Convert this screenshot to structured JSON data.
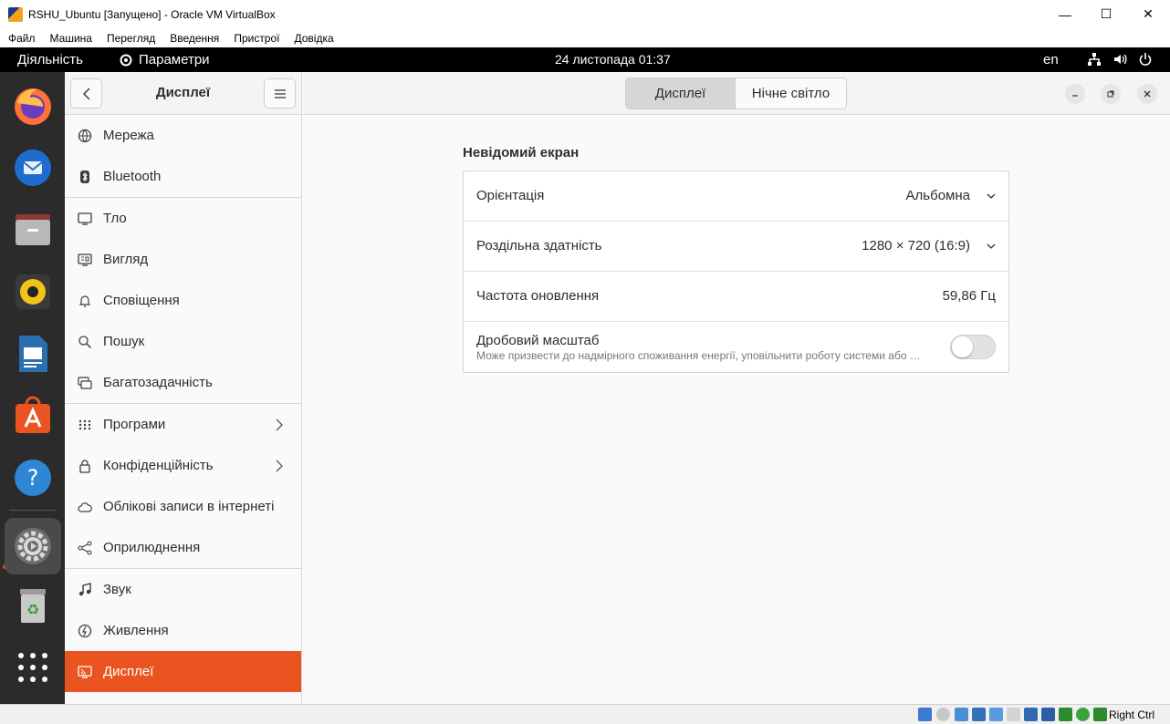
{
  "host_window": {
    "title": "RSHU_Ubuntu [Запущено] - Oracle VM VirtualBox",
    "menu": [
      "Файл",
      "Машина",
      "Перегляд",
      "Введення",
      "Пристрої",
      "Довідка"
    ],
    "minimize": "—",
    "maximize": "☐",
    "close": "✕"
  },
  "topbar": {
    "activities": "Діяльність",
    "app_name": "Параметри",
    "clock": "24 листопада  01:37",
    "lang": "en"
  },
  "dock": {
    "apps": [
      "firefox-icon",
      "thunderbird-icon",
      "files-icon",
      "rhythmbox-icon",
      "writer-icon",
      "software-icon",
      "help-icon",
      "settings-icon",
      "trash-icon",
      "show-apps-icon"
    ],
    "active": "settings-icon"
  },
  "sidebar": {
    "title": "Дисплеї",
    "items": [
      {
        "label": "Мережа",
        "icon": "network-icon"
      },
      {
        "label": "Bluetooth",
        "icon": "bluetooth-icon"
      },
      {
        "label": "Тло",
        "icon": "background-icon"
      },
      {
        "label": "Вигляд",
        "icon": "appearance-icon"
      },
      {
        "label": "Сповіщення",
        "icon": "bell-icon"
      },
      {
        "label": "Пошук",
        "icon": "search-icon"
      },
      {
        "label": "Багатозадачність",
        "icon": "multitasking-icon"
      },
      {
        "label": "Програми",
        "icon": "apps-grid-icon"
      },
      {
        "label": "Конфіденційність",
        "icon": "lock-icon"
      },
      {
        "label": "Облікові записи в інтернеті",
        "icon": "cloud-icon"
      },
      {
        "label": "Оприлюднення",
        "icon": "share-icon"
      },
      {
        "label": "Звук",
        "icon": "music-note-icon"
      },
      {
        "label": "Живлення",
        "icon": "power-icon"
      },
      {
        "label": "Дисплеї",
        "icon": "display-icon"
      }
    ],
    "selected": "Дисплеї"
  },
  "main": {
    "tabs": [
      "Дисплеї",
      "Нічне світло"
    ],
    "active_tab": "Дисплеї",
    "section_title": "Невідомий екран",
    "rows": {
      "orientation": {
        "label": "Орієнтація",
        "value": "Альбомна"
      },
      "resolution": {
        "label": "Роздільна здатність",
        "value": "1280 × 720 (16:9)"
      },
      "refresh": {
        "label": "Частота оновлення",
        "value": "59,86 Гц"
      },
      "scale": {
        "label": "Дробовий масштаб",
        "description": "Може призвести до надмірного споживання енергії, уповільнити роботу системи або …",
        "enabled": false
      }
    }
  },
  "statusbar": {
    "host_key": "Right Ctrl"
  },
  "colors": {
    "accent": "#e95420",
    "dock_bg": "#2b2b2b",
    "topbar_bg": "#000000"
  }
}
